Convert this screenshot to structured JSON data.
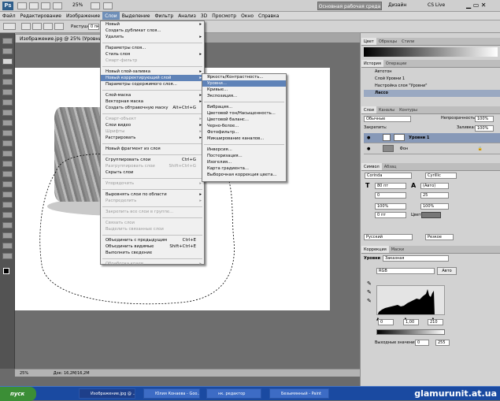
{
  "app": {
    "logo": "Ps",
    "zoom": "25%",
    "workspace_btn": "Основная рабочая среда",
    "design_btn": "Дизайн",
    "cslive": "CS Live"
  },
  "menubar": [
    "Файл",
    "Редактирование",
    "Изображение",
    "Слои",
    "Выделение",
    "Фильтр",
    "Анализ",
    "3D",
    "Просмотр",
    "Окно",
    "Справка"
  ],
  "options": {
    "feather_label": "Растушевка:",
    "feather_value": "0 пк"
  },
  "doc_tab": "Изображение.jpg @ 25% (Уровни 1",
  "status": {
    "zoom": "25%",
    "doc": "Док: 16,2M/16,2M"
  },
  "layer_menu": [
    {
      "t": "Новый",
      "ar": true
    },
    {
      "t": "Создать дубликат слоя..."
    },
    {
      "t": "Удалить",
      "ar": true
    },
    {
      "sep": true
    },
    {
      "t": "Параметры слоя..."
    },
    {
      "t": "Стиль слоя",
      "ar": true
    },
    {
      "t": "Смарт-фильтр",
      "dis": true
    },
    {
      "sep": true
    },
    {
      "t": "Новый слой-заливка",
      "ar": true
    },
    {
      "t": "Новый корректирующий слой",
      "ar": true,
      "hl": true
    },
    {
      "t": "Параметры содержимого слоя..."
    },
    {
      "sep": true
    },
    {
      "t": "Слой-маска",
      "ar": true
    },
    {
      "t": "Векторная маска",
      "ar": true
    },
    {
      "t": "Создать обтравочную маску",
      "sc": "Alt+Ctrl+G"
    },
    {
      "sep": true
    },
    {
      "t": "Смарт-объект",
      "ar": true,
      "dis": true
    },
    {
      "t": "Слои видео",
      "ar": true
    },
    {
      "t": "Шрифты",
      "ar": true,
      "dis": true
    },
    {
      "t": "Растрировать",
      "ar": true
    },
    {
      "sep": true
    },
    {
      "t": "Новый фрагмент из слоя"
    },
    {
      "sep": true
    },
    {
      "t": "Сгруппировать слои",
      "sc": "Ctrl+G"
    },
    {
      "t": "Разгруппировать слои",
      "sc": "Shift+Ctrl+G",
      "dis": true
    },
    {
      "t": "Скрыть слои"
    },
    {
      "sep": true
    },
    {
      "t": "Упорядочить",
      "ar": true,
      "dis": true
    },
    {
      "sep": true
    },
    {
      "t": "Выровнять слои по области",
      "ar": true
    },
    {
      "t": "Распределить",
      "ar": true,
      "dis": true
    },
    {
      "sep": true
    },
    {
      "t": "Закрепить все слои в группе...",
      "dis": true
    },
    {
      "sep": true
    },
    {
      "t": "Связать слои",
      "dis": true
    },
    {
      "t": "Выделить связанные слои",
      "dis": true
    },
    {
      "sep": true
    },
    {
      "t": "Объединить с предыдущим",
      "sc": "Ctrl+E"
    },
    {
      "t": "Объединить видимые",
      "sc": "Shift+Ctrl+E"
    },
    {
      "t": "Выполнить сведение"
    },
    {
      "sep": true
    },
    {
      "t": "Обработка краев",
      "ar": true,
      "dis": true
    }
  ],
  "adjust_menu": [
    {
      "t": "Яркость/Контрастность..."
    },
    {
      "t": "Уровни...",
      "hl": true
    },
    {
      "t": "Кривые..."
    },
    {
      "t": "Экспозиция..."
    },
    {
      "sep": true
    },
    {
      "t": "Вибрация..."
    },
    {
      "t": "Цветовой тон/Насыщенность..."
    },
    {
      "t": "Цветовой баланс..."
    },
    {
      "t": "Черно-белое..."
    },
    {
      "t": "Фотофильтр..."
    },
    {
      "t": "Микширование каналов..."
    },
    {
      "sep": true
    },
    {
      "t": "Инверсия..."
    },
    {
      "t": "Постеризация..."
    },
    {
      "t": "Изогелия..."
    },
    {
      "t": "Карта градиента..."
    },
    {
      "t": "Выборочная коррекция цвета..."
    }
  ],
  "panels": {
    "color_tabs": [
      "Цвет",
      "Образцы",
      "Стили"
    ],
    "history_tabs": [
      "История",
      "Операции"
    ],
    "history": [
      "Автотон",
      "Слой Уровни 1",
      "Настройка слоя \"Уровни\""
    ],
    "history_sel": "Лассо",
    "layers_tabs": [
      "Слои",
      "Каналы",
      "Контуры"
    ],
    "blend": "Обычные",
    "opacity_label": "Непрозрачность:",
    "opacity": "100%",
    "lock_label": "Закрепить:",
    "fill_label": "Заливка:",
    "fill": "100%",
    "layers": [
      "Уровни 1",
      "Фон"
    ],
    "char_tabs": [
      "Символ",
      "Абзац"
    ],
    "font": "Corinda",
    "font_style": "Cyrillic",
    "size": "80 пт",
    "leading": "(Авто)",
    "kern": "0",
    "track": "25",
    "scale_v": "100%",
    "scale_h": "100%",
    "baseline": "0 пт",
    "color_label": "Цвет:",
    "lang": "Русский",
    "aa": "Резкое",
    "adj_tabs": [
      "Коррекция",
      "Маски"
    ],
    "adj_label": "Уровни",
    "preset": "Заказная",
    "channel": "RGB",
    "auto": "Авто",
    "in_vals": [
      "0",
      "1,00",
      "210"
    ],
    "out_label": "Выходные значения:",
    "out_vals": [
      "0",
      "255"
    ]
  },
  "taskbar": {
    "start": "пуск",
    "tasks": [
      "Изображение.jpg @ ...",
      "Юлия Конаева - Goo...",
      "нк. редактор",
      "Безымянный - Paint"
    ],
    "watermark": "glamurunit.at.ua"
  }
}
